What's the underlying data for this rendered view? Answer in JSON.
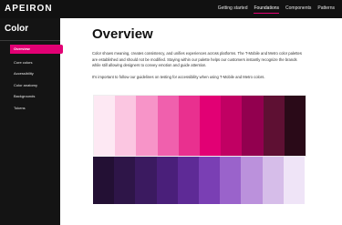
{
  "header": {
    "logo": "APEIRON",
    "nav": [
      "Getting started",
      "Foundations",
      "Components",
      "Patterns"
    ]
  },
  "sidebar": {
    "title": "Color",
    "items": [
      "Overview",
      "Core colors",
      "Accessibility",
      "Color anatomy",
      "Backgrounds",
      "Tokens"
    ]
  },
  "main": {
    "title": "Overview",
    "para1": "Color shows meaning, creates consistency, and unifies experiences across platforms. The T-Mobile and Metro color palettes are established and should not be modified. Staying within our palette helps our customers instantly recognize the brands while still allowing designers to convey emotion and guide attention.",
    "para2": "It's important to follow our guidelines on testing for accessibility when using T-Mobile and Metro colors."
  },
  "palette": {
    "magenta": [
      "#fde8f3",
      "#fbc6e1",
      "#f794c8",
      "#f060ad",
      "#e9308f",
      "#e20074",
      "#c10063",
      "#92004f",
      "#5e1033",
      "#2a0a18"
    ],
    "purple": [
      "#231034",
      "#2e1548",
      "#3b1a60",
      "#4a1f7a",
      "#5e2a96",
      "#7a3fb4",
      "#9a63cb",
      "#bb91dc",
      "#d6bde9",
      "#efe4f7"
    ]
  },
  "colors": {
    "accent": "#e20074",
    "topbar": "#111111",
    "sidebar": "#141414"
  }
}
